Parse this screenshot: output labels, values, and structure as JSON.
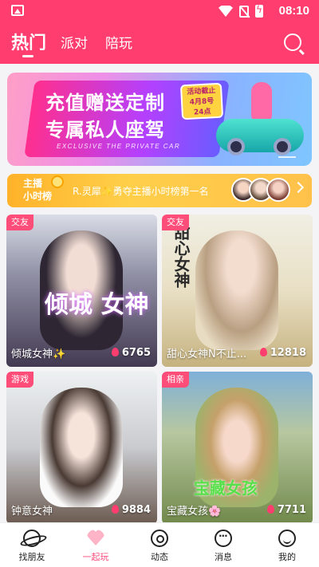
{
  "statusbar": {
    "time": "08:10"
  },
  "header": {
    "tabs": [
      {
        "label": "热门"
      },
      {
        "label": "派对"
      },
      {
        "label": "陪玩"
      }
    ]
  },
  "banner": {
    "line1": "充值赠送定制",
    "line2": "专属私人座驾",
    "english": "EXCLUSIVE THE PRIVATE CAR",
    "badge": [
      "活动截止",
      "4月8号",
      "24点"
    ]
  },
  "ranking": {
    "title_line1": "主播",
    "title_line2": "小时榜",
    "text": "R.灵犀✨勇夺主播小时榜第一名"
  },
  "cards": [
    {
      "tag": "交友",
      "name": "倾城女神✨",
      "count": "6765",
      "deco": "倾城 女神"
    },
    {
      "tag": "交友",
      "name": "甜心女神N不止...",
      "count": "12818",
      "deco": "甜心女神"
    },
    {
      "tag": "游戏",
      "name": "钟意女神",
      "count": "9884",
      "deco": ""
    },
    {
      "tag": "相亲",
      "name": "宝藏女孩🌸",
      "count": "7711",
      "deco": "宝藏女孩"
    }
  ],
  "bottomnav": [
    {
      "label": "找朋友",
      "icon": "planet-icon"
    },
    {
      "label": "一起玩",
      "icon": "heart-icon",
      "active": true
    },
    {
      "label": "动态",
      "icon": "moments-icon"
    },
    {
      "label": "消息",
      "icon": "message-icon"
    },
    {
      "label": "我的",
      "icon": "profile-icon"
    }
  ],
  "colors": {
    "accent": "#ff3d6e",
    "tag": "#ff4d79",
    "ranking": "#ffc14a"
  }
}
